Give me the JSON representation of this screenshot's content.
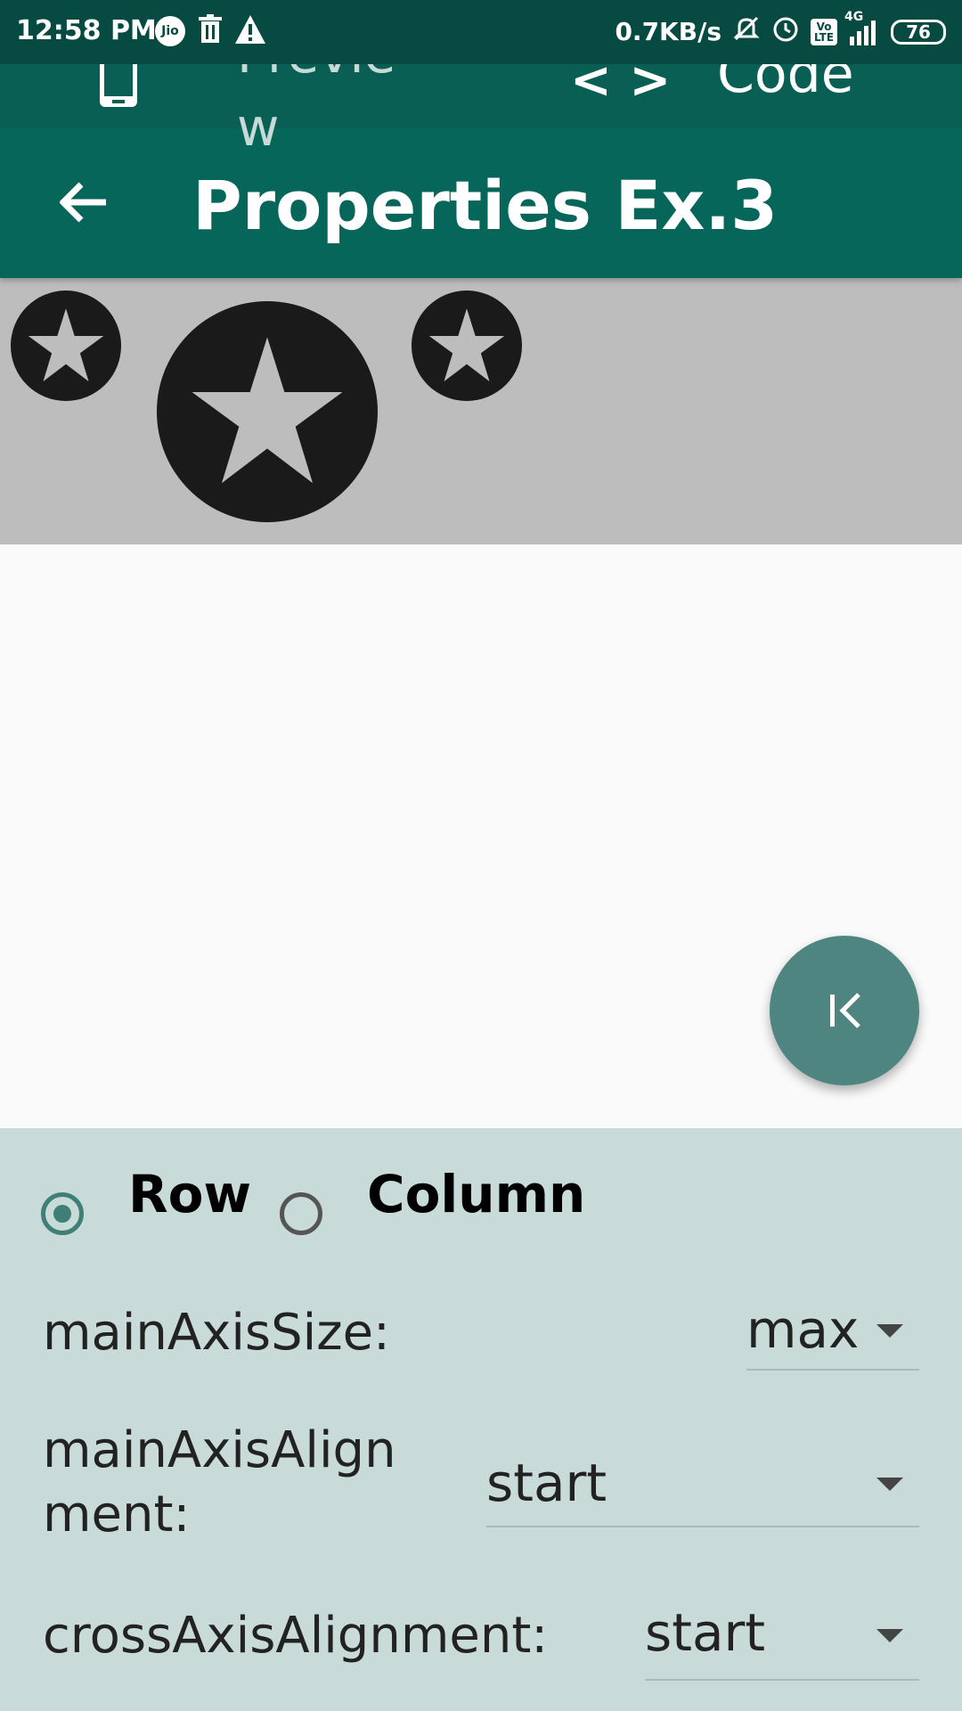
{
  "status_bar": {
    "time": "12:58 PM",
    "carrier_badge": "Jio",
    "network_speed": "0.7KB/s",
    "volte_badge": "Vo LTE",
    "network_type": "4G",
    "battery_level": "76"
  },
  "tabs": {
    "preview_label": "Preview",
    "code_label": "Code",
    "code_icon_glyph": "< >"
  },
  "app_bar": {
    "title": "Properties Ex.3"
  },
  "layout_options": {
    "row_label": "Row",
    "column_label": "Column",
    "selected": "Row"
  },
  "properties": [
    {
      "label": "mainAxisSize:",
      "value": "max"
    },
    {
      "label": "mainAxisAlignment:",
      "value": "start"
    },
    {
      "label": "crossAxisAlignment:",
      "value": "start"
    }
  ],
  "colors": {
    "app_bar": "#07665a",
    "status_bar": "#064a41",
    "fab": "#4e8580",
    "controls_bg": "#c8dbd9",
    "preview_bg": "#bdbdbd"
  }
}
